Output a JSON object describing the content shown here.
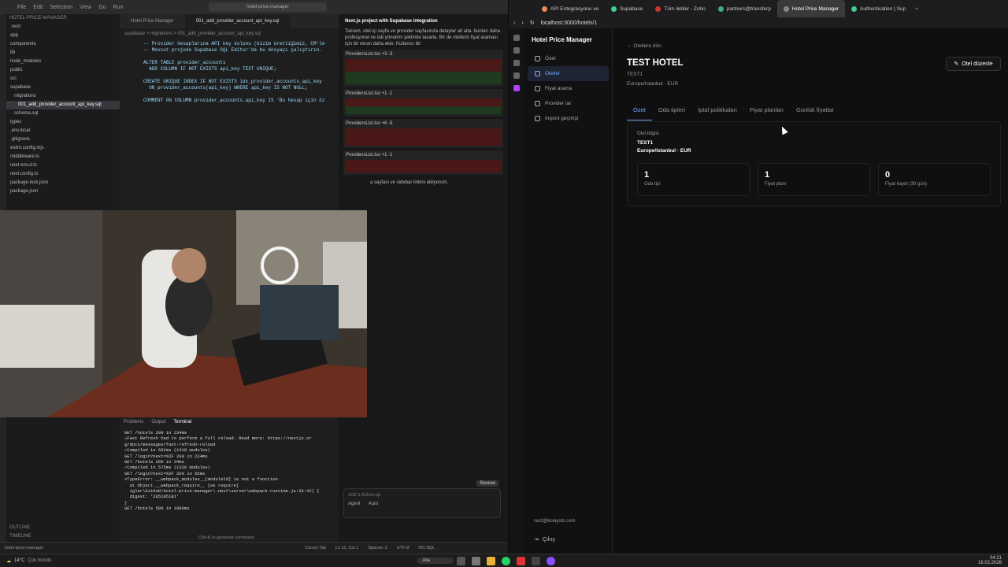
{
  "ide": {
    "menu": [
      "File",
      "Edit",
      "Selection",
      "View",
      "Go",
      "Run"
    ],
    "search": "hotel-price-manager",
    "explorer": {
      "root": "HOTEL-PRICE-MANAGER",
      "items": [
        ".next",
        "app",
        "components",
        "lib",
        "node_modules",
        "public",
        "src",
        "supabase",
        "migrations",
        "001_add_provider_account_api_key.sql",
        "schema.sql",
        "types",
        ".env.local",
        ".gitignore",
        "eslint.config.mjs",
        "middleware.ts",
        "next-env.d.ts",
        "next.config.ts",
        "package-lock.json",
        "package.json"
      ],
      "footer": [
        "OUTLINE",
        "TIMELINE"
      ]
    },
    "tabs": [
      "Hotel Price Manager",
      "001_add_provider_account_api_key.sql"
    ],
    "breadcrumb": "supabase > migrations > 001_add_provider_account_api_key.sql",
    "code": "-- Provider hesaplarına API key kolonu (bizim ürettiğimiz, CM'le\n-- Mevcut projede Supabase SQL Editor'da bu dosyayı çalıştırın.\n\nALTER TABLE provider_accounts\n  ADD COLUMN IF NOT EXISTS api_key TEXT UNIQUE;\n\nCREATE UNIQUE INDEX IF NOT EXISTS idx_provider_accounts_api_key\n  ON provider_accounts(api_key) WHERE api_key IS NOT NULL;\n\nCOMMENT ON COLUMN provider_accounts.api_key IS 'Bu hesap için öz",
    "terminal": {
      "tabs": [
        "Problems",
        "Output",
        "Terminal"
      ],
      "lines": "GET /hotels 200 in 234ms\n⚠Fast Refresh had to perform a full reload. Read more: https://nextjs.or\ng/docs/messages/fast-refresh-reload\n✓Compiled in 692ms (1318 modules)\nGET /login?next=%2F 200 in 234ms\nGET /hotels 200 in 34ms\n✓Compiled in 575ms (1320 modules)\nGET /login?next=%2F 200 in 65ms\n⨯TypeError: __webpack_modules__[moduleId] is not a function\n  at Object.__webpack_require__ [as require]\n  igler\\GitHub\\hotel-price-manager\\.next\\server\\webpack-runtime.js:33:42) {\n  digest: '285105181'\n}\nGET /hotels 500 in 1990ms",
      "hint": "Ctrl+K to generate command"
    },
    "agent": {
      "title": "Next.js project with Supabase integration",
      "intro": "Tamam, otel içi sayfa ve provider sayfasında detaylar alt alta. bunları daha profesyonel ve tab yönetimi şeklinde tasarla. Bir de otellerin fiyat araması için bir ekran daha ekle. Kullanıcı bir",
      "files": [
        "ProvidersList.tsx +3 -3",
        "ProvidersList.tsx +1 -1",
        "ProvidersList.tsx +6 -5",
        "ProvidersList.tsx +1 -1"
      ],
      "note": "a sayfası ve sidebar linkini ekliyorum.",
      "input": "Add a follow-up",
      "mode": "Agent",
      "model": "Auto",
      "review": "Review"
    },
    "statusbar": [
      "hotel-price-manager",
      "Cursor Tab",
      "Ln 11, Col 1",
      "Spaces: 2",
      "UTF-8",
      "MS SQL"
    ]
  },
  "browser": {
    "tabs": [
      {
        "label": "API Entegrasyonu ve",
        "color": "#e85"
      },
      {
        "label": "Supabase",
        "color": "#3ecf8e"
      },
      {
        "label": "Tüm iletiler - Zoho",
        "color": "#c33"
      },
      {
        "label": "partners@transferp",
        "color": "#4a8"
      },
      {
        "label": "Hotel Price Manager",
        "color": "#888",
        "active": true
      },
      {
        "label": "Authentication | Sup",
        "color": "#3ecf8e"
      }
    ],
    "url": "localhost:3000/hotels/1",
    "app": {
      "brand": "Hotel Price Manager",
      "nav": [
        {
          "label": "Özet",
          "icon": "dashboard-icon"
        },
        {
          "label": "Oteller",
          "icon": "building-icon",
          "active": true
        },
        {
          "label": "Fiyat arama",
          "icon": "search-icon"
        },
        {
          "label": "Provider lar",
          "icon": "plug-icon"
        },
        {
          "label": "Import geçmişi",
          "icon": "inbox-icon"
        }
      ],
      "user": "rasit@kolayotc.com",
      "logout": "Çıkış",
      "back": "← Otellere dön",
      "hotel": {
        "name": "TEST HOTEL",
        "code": "TEST1",
        "meta": "Europe/Istanbul · EUR"
      },
      "edit": "Otel düzenle",
      "tabs": [
        "Özet",
        "Oda tipleri",
        "İptal politikaları",
        "Fiyat planları",
        "Günlük fiyatlar"
      ],
      "card": {
        "label": "Otel bilgisi",
        "code": "TEST1",
        "meta": "Europe/Istanbul · EUR",
        "stats": [
          {
            "value": "1",
            "label": "Oda tipi"
          },
          {
            "value": "1",
            "label": "Fiyat planı"
          },
          {
            "value": "0",
            "label": "Fiyat kaydı (30 gün)"
          }
        ]
      }
    }
  },
  "taskbar": {
    "weather": "14°C",
    "weather_desc": "Çok bulutlu",
    "search": "Ara",
    "time": "04:21",
    "date": "16.02.2026"
  },
  "colors": {
    "accent": "#7aa7ff",
    "bg": "#0f0f10"
  }
}
